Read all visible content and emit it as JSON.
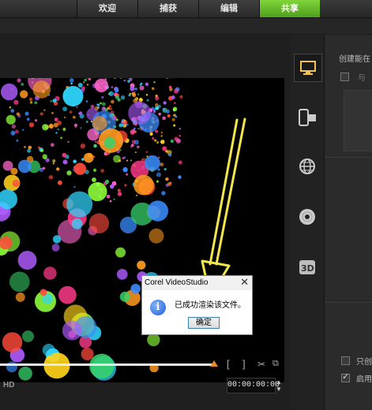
{
  "tabs": [
    "欢迎",
    "捕获",
    "编辑",
    "共享"
  ],
  "active_tab": "共享",
  "share_panel": {
    "create_title": "创建能在",
    "option1": "与",
    "bottom_option1": "只创",
    "bottom_option2": "启用"
  },
  "preview": {
    "quality_label": "HD",
    "timecode": "00:00:00:00",
    "mark_in": "[",
    "mark_out": "]"
  },
  "dialog": {
    "title": "Corel VideoStudio",
    "message": "已成功渲染该文件。",
    "ok_label": "确定",
    "close": "✕"
  },
  "colors": {
    "active_tab": "#5fb026",
    "annotation_arrow": "#f2e64b",
    "scrub_head": "#f08a24"
  },
  "icons": [
    "monitor-icon",
    "mobile-device-icon",
    "web-globe-icon",
    "disc-icon",
    "3d-icon"
  ]
}
